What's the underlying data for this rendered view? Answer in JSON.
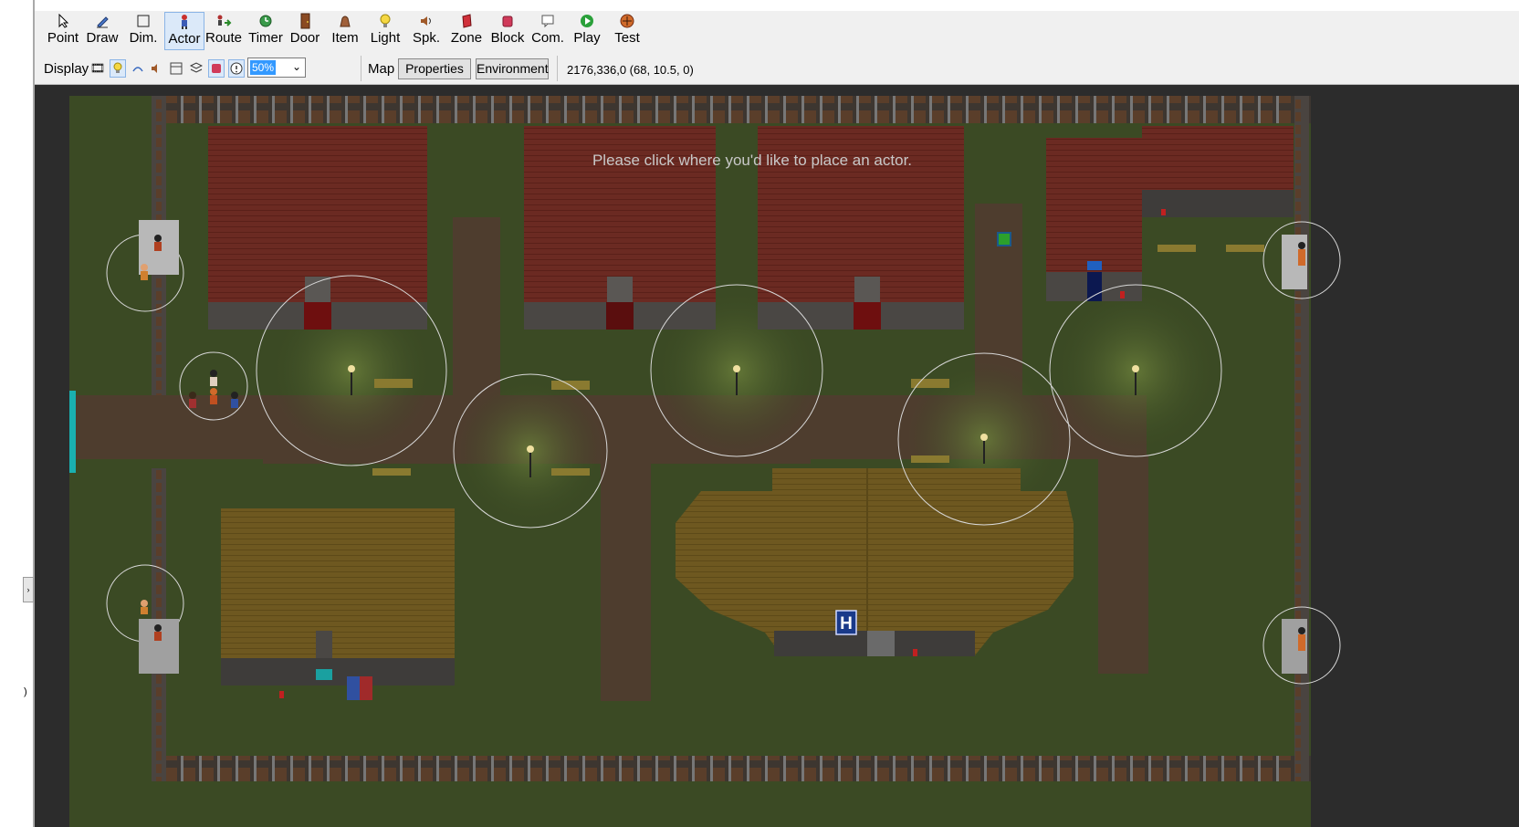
{
  "toolbar": {
    "tools": [
      {
        "label": "Point",
        "icon": "cursor-icon"
      },
      {
        "label": "Draw",
        "icon": "pencil-icon"
      },
      {
        "label": "Dim.",
        "icon": "dimension-square-icon"
      },
      {
        "label": "Actor",
        "icon": "actor-icon",
        "active": true
      },
      {
        "label": "Route",
        "icon": "route-icon"
      },
      {
        "label": "Timer",
        "icon": "timer-icon"
      },
      {
        "label": "Door",
        "icon": "door-icon"
      },
      {
        "label": "Item",
        "icon": "item-bag-icon"
      },
      {
        "label": "Light",
        "icon": "lightbulb-icon"
      },
      {
        "label": "Spk.",
        "icon": "speaker-icon"
      },
      {
        "label": "Zone",
        "icon": "zone-icon"
      },
      {
        "label": "Block",
        "icon": "block-icon"
      },
      {
        "label": "Com.",
        "icon": "comment-icon"
      },
      {
        "label": "Play",
        "icon": "play-icon"
      },
      {
        "label": "Test",
        "icon": "test-icon"
      }
    ]
  },
  "display": {
    "label": "Display",
    "zoom": "50%"
  },
  "map": {
    "label": "Map",
    "properties_label": "Properties",
    "environment_label": "Environment",
    "coordinates": "2176,336,0 (68, 10.5, 0)"
  },
  "canvas": {
    "message": "Please click where you'd like to place an actor.",
    "hospital_sign": "H"
  },
  "colors": {
    "grass": "#3b4a24",
    "roof_red": "#6b2a22",
    "roof_brown": "#6e5820",
    "path": "#4e3d2e",
    "fence": "#5a4a3a",
    "accent_active": "#dbe9f9"
  }
}
